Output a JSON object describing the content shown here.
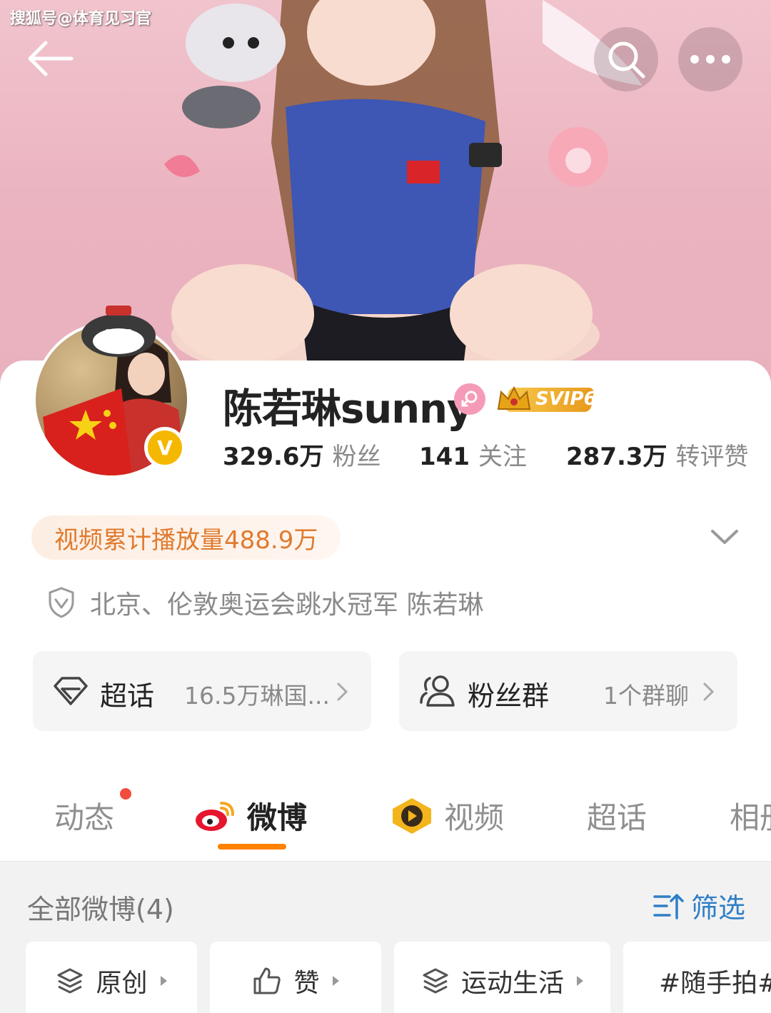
{
  "watermark": "搜狐号@体育见习官",
  "profile": {
    "name": "陈若琳sunny",
    "svip_badge": "SVIP6",
    "verified_mark": "V",
    "stats": [
      {
        "value": "329.6万",
        "label": "粉丝"
      },
      {
        "value": "141",
        "label": "关注"
      },
      {
        "value": "287.3万",
        "label": "转评赞"
      }
    ],
    "video_plays": "视频累计播放量488.9万",
    "bio": "北京、伦敦奥运会跳水冠军 陈若琳"
  },
  "cards": {
    "super_topic": {
      "title": "超话",
      "value": "16.5万琳国..."
    },
    "fan_group": {
      "title": "粉丝群",
      "value": "1个群聊"
    }
  },
  "tabs": [
    {
      "label": "动态"
    },
    {
      "label": "微博"
    },
    {
      "label": "视频"
    },
    {
      "label": "超话"
    },
    {
      "label": "相册"
    }
  ],
  "feed": {
    "title": "全部微博(4)",
    "filter_label": "筛选",
    "chips": [
      "原创",
      "赞",
      "运动生活",
      "#随手拍#"
    ]
  },
  "colors": {
    "accent_orange": "#ff8200",
    "filter_blue": "#2f7fc6",
    "banner_pink": "#eab3bf"
  },
  "icons": [
    "back-arrow-icon",
    "search-icon",
    "more-icon",
    "gender-female-icon",
    "shield-check-icon",
    "diamond-icon",
    "group-icon",
    "weibo-logo-icon",
    "video-play-icon",
    "layers-icon",
    "thumbs-up-icon",
    "sort-filter-icon"
  ]
}
